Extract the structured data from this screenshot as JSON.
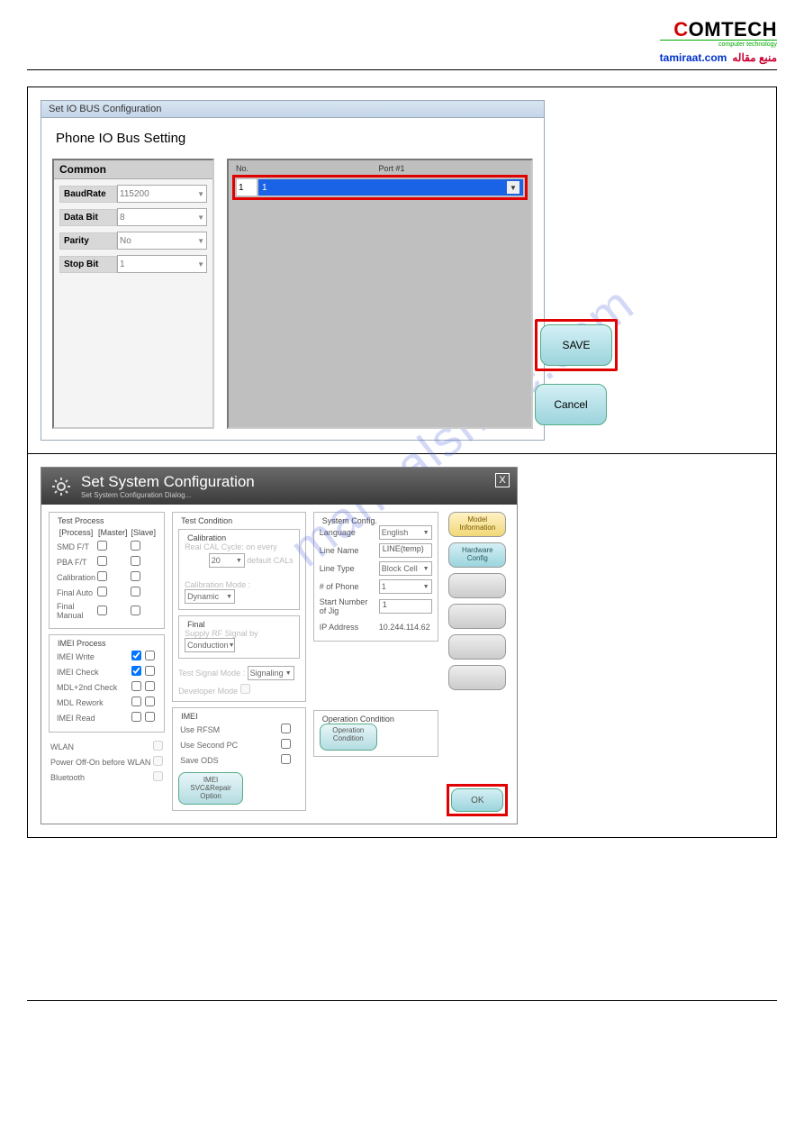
{
  "header": {
    "logo_c": "C",
    "logo_rest": "OMTECH",
    "logo_sub": "computer technology",
    "source_link": "tamiraat.com",
    "source_label": "منبع مقاله"
  },
  "watermark": "manualshive.com",
  "screen1": {
    "title": "Set IO BUS Configuration",
    "subtitle": "Phone IO Bus Setting",
    "common": {
      "header": "Common",
      "rows": {
        "baudrate": {
          "label": "BaudRate",
          "value": "115200"
        },
        "databit": {
          "label": "Data Bit",
          "value": "8"
        },
        "parity": {
          "label": "Parity",
          "value": "No"
        },
        "stopbit": {
          "label": "Stop Bit",
          "value": "1"
        }
      }
    },
    "port_table": {
      "col_no": "No.",
      "col_port": "Port #1",
      "row_no": "1",
      "row_port": "1"
    },
    "save_label": "SAVE",
    "cancel_label": "Cancel"
  },
  "screen2": {
    "title": "Set System Configuration",
    "subtitle": "Set System Configuration Dialog...",
    "test_process": {
      "legend": "Test Process",
      "col_process": "[Process]",
      "col_master": "[Master]",
      "col_slave": "[Slave]",
      "rows": [
        "SMD F/T",
        "PBA F/T",
        "Calibration",
        "Final Auto",
        "Final Manual"
      ]
    },
    "imei_process": {
      "legend": "IMEI Process",
      "rows": [
        "IMEI Write",
        "IMEI Check",
        "MDL+2nd Check",
        "MDL Rework",
        "IMEI Read"
      ],
      "checked": [
        true,
        true,
        false,
        false,
        false
      ]
    },
    "misc": {
      "wlan": "WLAN",
      "poweroff": "Power Off-On before WLAN",
      "bluetooth": "Bluetooth"
    },
    "test_condition": {
      "legend": "Test Condition",
      "calibration_sub": "Calibration",
      "real_cal": "Real CAL Cycle: on every",
      "real_cal_val": "20",
      "real_cal_suffix": "default CALs",
      "cal_mode_label": "Calibration Mode :",
      "cal_mode_val": "Dynamic",
      "final_sub": "Final",
      "supply_rf": "Supply RF Signal by",
      "supply_rf_val": "Conduction",
      "test_signal": "Test Signal Mode :",
      "test_signal_val": "Signaling",
      "dev_mode": "Developer Mode"
    },
    "imei_group": {
      "legend": "IMEI",
      "use_rfsm": "Use RFSM",
      "use_second": "Use Second PC",
      "save_ods": "Save ODS",
      "btn": "IMEI SVC&Repair Option"
    },
    "system_config": {
      "legend": "System Config.",
      "language": {
        "label": "Language",
        "value": "English"
      },
      "line_name": {
        "label": "Line Name",
        "value": "LINE(temp)"
      },
      "line_type": {
        "label": "Line Type",
        "value": "Block Cell"
      },
      "phones": {
        "label": "# of Phone",
        "value": "1"
      },
      "start_jig": {
        "label": "Start Number of Jig",
        "value": "1"
      },
      "ip": {
        "label": "IP Address",
        "value": "10.244.114.62"
      }
    },
    "operation_condition": {
      "legend": "Operation Condition",
      "btn": "Operation Condition"
    },
    "side_buttons": {
      "model_info": "Model Information",
      "hw_config": "Hardware Config",
      "ok": "OK"
    }
  }
}
